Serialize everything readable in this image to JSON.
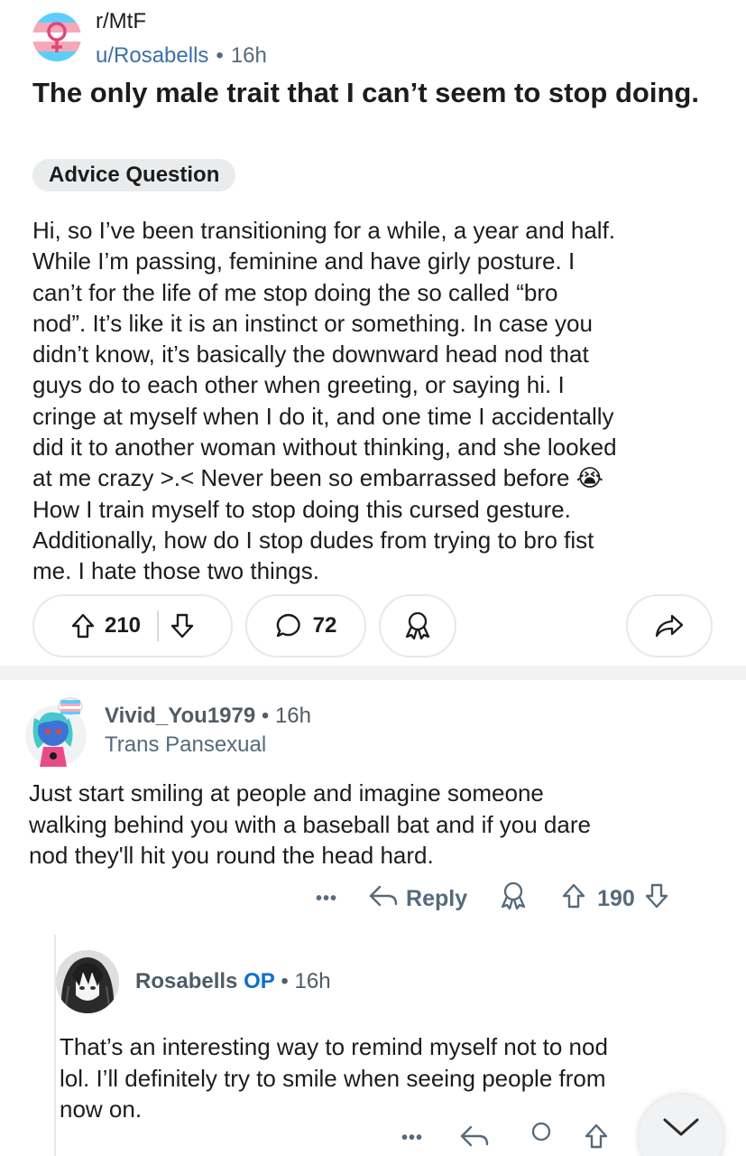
{
  "post": {
    "subreddit": "r/MtF",
    "author": "u/Rosabells",
    "time": "16h",
    "title": "The only male trait that I can’t seem to stop doing.",
    "flair": "Advice Question",
    "body_lines": [
      "Hi, so I’ve been transitioning for a while, a year and half.",
      "While I’m passing, feminine and have girly posture. I",
      "can’t for the life of me stop doing the so called “bro",
      "nod”. It’s like it is an instinct or something. In case you",
      "didn’t know, it’s basically the downward head nod that",
      "guys do to each other when greeting, or saying hi. I",
      "cringe at myself when I do it, and one time I accidentally",
      "did it to another woman without thinking, and she looked",
      "at me crazy >.< Never been so embarrassed before 😭",
      "How I train myself to stop doing this cursed gesture.",
      "Additionally, how do I stop dudes from trying to bro fist",
      "me. I hate those two things."
    ],
    "upvotes": "210",
    "comments": "72"
  },
  "comment1": {
    "username": "Vivid_You1979",
    "time": "16h",
    "flair": "Trans Pansexual",
    "body_lines": [
      "Just start smiling at people and imagine someone",
      "walking behind you with a baseball bat and if you dare",
      "nod they'll hit you round the head hard."
    ],
    "more": "•••",
    "reply_label": "Reply",
    "score": "190"
  },
  "comment2": {
    "username": "Rosabells",
    "op_tag": "OP",
    "time": "16h",
    "body_lines": [
      "That’s an interesting way to remind myself not to nod",
      "lol. I’ll definitely try to smile when seeing people from",
      "now on."
    ],
    "more": "•••"
  },
  "colors": {
    "meta_gray": "#566a7c",
    "op_blue": "#0a6fd6",
    "flair_bg": "#e9ebed",
    "trans_blue": "#5bcefa",
    "trans_pink": "#f5a9b8"
  },
  "icons": {
    "subreddit": "trans-symbol-icon",
    "upvote": "arrow-up-icon",
    "downvote": "arrow-down-icon",
    "comments": "speech-bubble-icon",
    "award": "award-ribbon-icon",
    "share": "share-arrow-icon",
    "reply": "reply-arrow-icon",
    "scroll": "chevron-down-icon"
  }
}
